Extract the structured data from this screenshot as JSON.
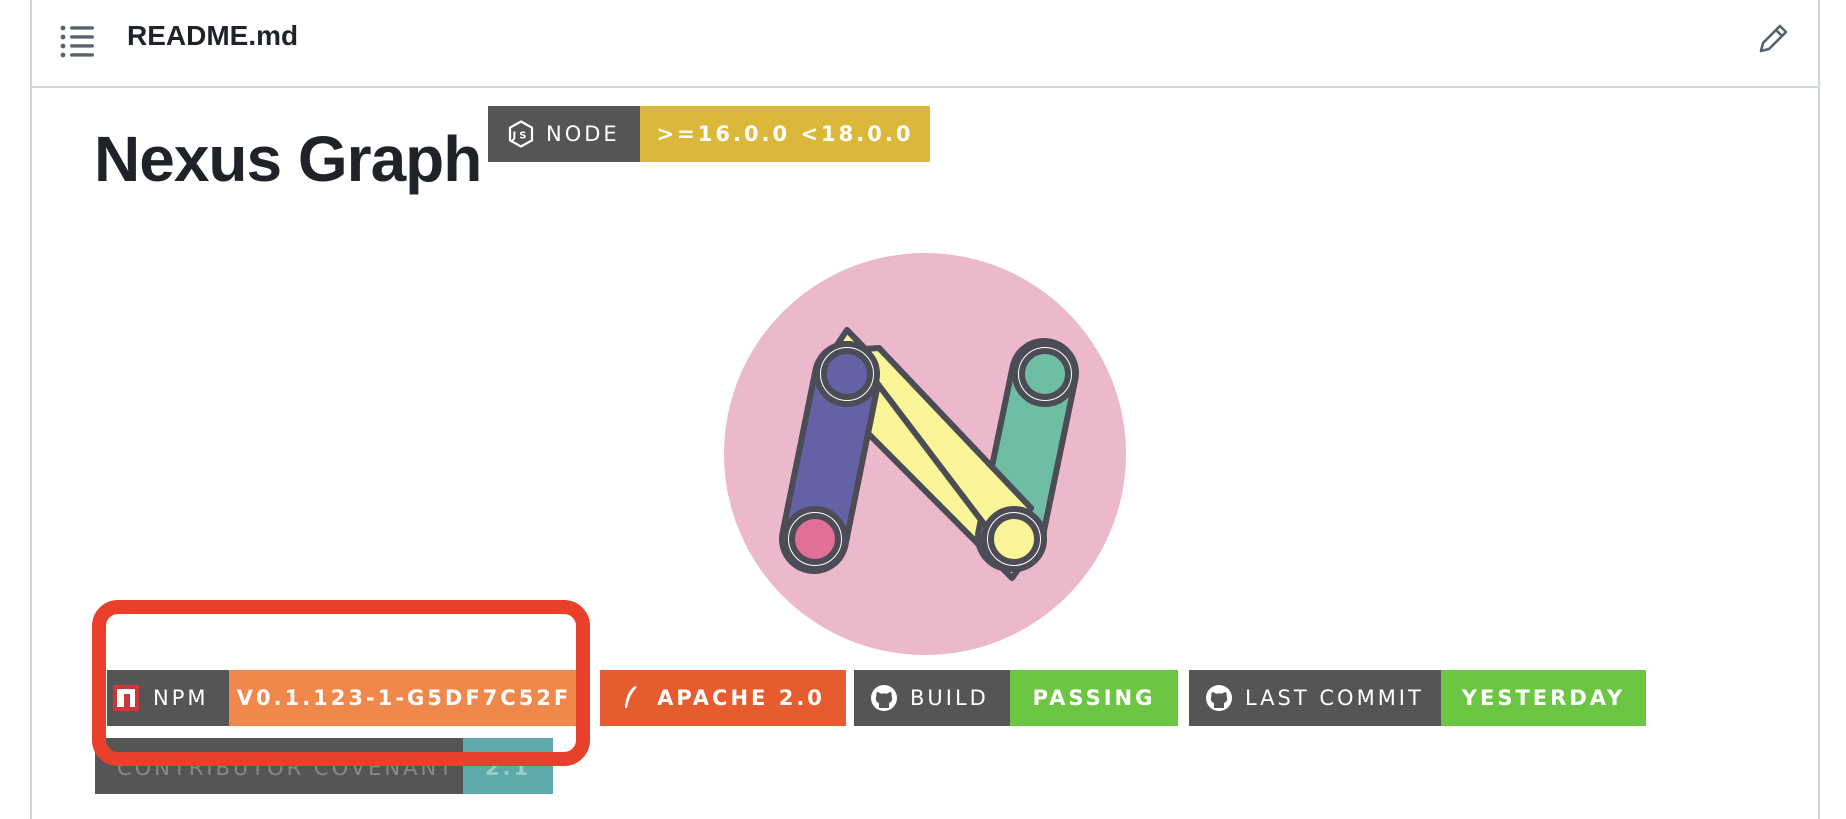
{
  "file_header": {
    "filename": "README.md",
    "toc_icon": "list-icon",
    "edit_icon": "pencil-icon"
  },
  "readme": {
    "title": "Nexus Graph",
    "logo_icon": "nexus-graph-logo",
    "badges": {
      "node": {
        "label": "NODE",
        "value": ">=16.0.0 <18.0.0",
        "icon": "nodejs-icon",
        "value_color": "#dbb73a"
      },
      "npm": {
        "label": "NPM",
        "value": "V0.1.123-1-G5DF7C52F",
        "icon": "npm-icon",
        "value_color": "#f0874b"
      },
      "license": {
        "value": "APACHE 2.0",
        "icon": "feather-icon",
        "value_color": "#e65c2e"
      },
      "build": {
        "label": "BUILD",
        "value": "PASSING",
        "icon": "github-icon",
        "value_color": "#6cc644"
      },
      "last_commit": {
        "label": "LAST COMMIT",
        "value": "YESTERDAY",
        "icon": "github-icon",
        "value_color": "#6cc644"
      },
      "contributor_covenant": {
        "label": "CONTRIBUTOR COVENANT",
        "value": "2.1",
        "value_color": "#5ea9aa"
      }
    }
  },
  "annotation": {
    "color": "#e8402b"
  }
}
